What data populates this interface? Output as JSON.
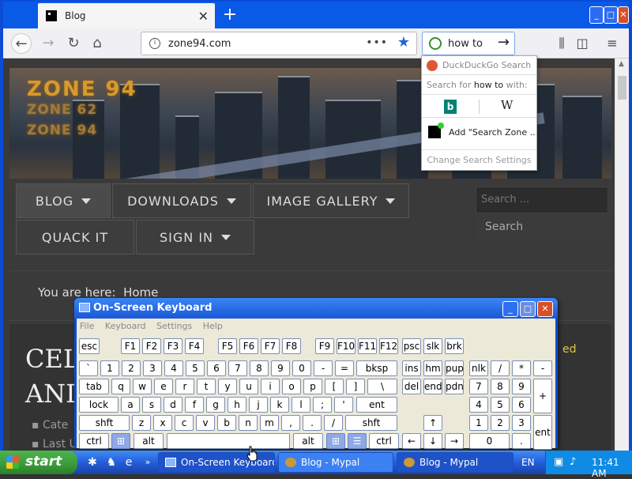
{
  "browser": {
    "tab_title": "Blog",
    "tab_close": "✕",
    "new_tab": "+",
    "url": "zone94.com",
    "url_dots": "•••",
    "search_query": "how to",
    "window_buttons": [
      "_",
      "□",
      "✕"
    ]
  },
  "search_dropdown": {
    "engine_label": "DuckDuckGo Search",
    "search_for_prefix": "Search for",
    "search_for_query": "how to",
    "search_for_suffix": "with:",
    "bing": "b",
    "wiki": "W",
    "add_engine": "Add \"Search Zone ...",
    "settings": "Change Search Settings"
  },
  "site": {
    "logo_main": "ZONE 94",
    "logo_sub1": "ZONE 62",
    "logo_sub2": "ZONE 94",
    "menu": [
      "BLOG",
      "DOWNLOADS",
      "IMAGE GALLERY",
      "QUACK IT",
      "SIGN IN"
    ],
    "search_placeholder": "Search ...",
    "search_button": "Search",
    "breadcrumb_prefix": "You are here:",
    "breadcrumb_home": "Home",
    "article_title_line1": "CELL",
    "article_title_line2": "AND",
    "meta_category": "Cate",
    "meta_last": "Last U",
    "side_text": "ed"
  },
  "osk": {
    "title": "On-Screen Keyboard",
    "menu": [
      "File",
      "Keyboard",
      "Settings",
      "Help"
    ],
    "row0": [
      "esc",
      "F1",
      "F2",
      "F3",
      "F4",
      "F5",
      "F6",
      "F7",
      "F8",
      "F9",
      "F10",
      "F11",
      "F12",
      "psc",
      "slk",
      "brk"
    ],
    "row1": [
      "`",
      "1",
      "2",
      "3",
      "4",
      "5",
      "6",
      "7",
      "8",
      "9",
      "0",
      "-",
      "=",
      "bksp",
      "ins",
      "hm",
      "pup",
      "nlk",
      "/",
      "*",
      "-"
    ],
    "row2": [
      "tab",
      "q",
      "w",
      "e",
      "r",
      "t",
      "y",
      "u",
      "i",
      "o",
      "p",
      "[",
      "]",
      "\\",
      "del",
      "end",
      "pdn",
      "7",
      "8",
      "9",
      "+"
    ],
    "row3": [
      "lock",
      "a",
      "s",
      "d",
      "f",
      "g",
      "h",
      "j",
      "k",
      "l",
      ";",
      "'",
      "ent",
      "4",
      "5",
      "6"
    ],
    "row4": [
      "shft",
      "z",
      "x",
      "c",
      "v",
      "b",
      "n",
      "m",
      ",",
      ".",
      "/",
      "shft",
      "↑",
      "1",
      "2",
      "3",
      "ent"
    ],
    "row5": [
      "ctrl",
      "alt",
      "alt",
      "ctrl",
      "←",
      "↓",
      "→",
      "0",
      "."
    ]
  },
  "taskbar": {
    "start": "start",
    "tasks": [
      "On-Screen Keyboard",
      "Blog - Mypal",
      "Blog - Mypal"
    ],
    "lang": "EN",
    "clock": "11:41 AM"
  },
  "colors": {
    "xp_blue": "#0a4cd6",
    "accent_gold": "#d79a2b",
    "start_green": "#3a9a3a"
  }
}
